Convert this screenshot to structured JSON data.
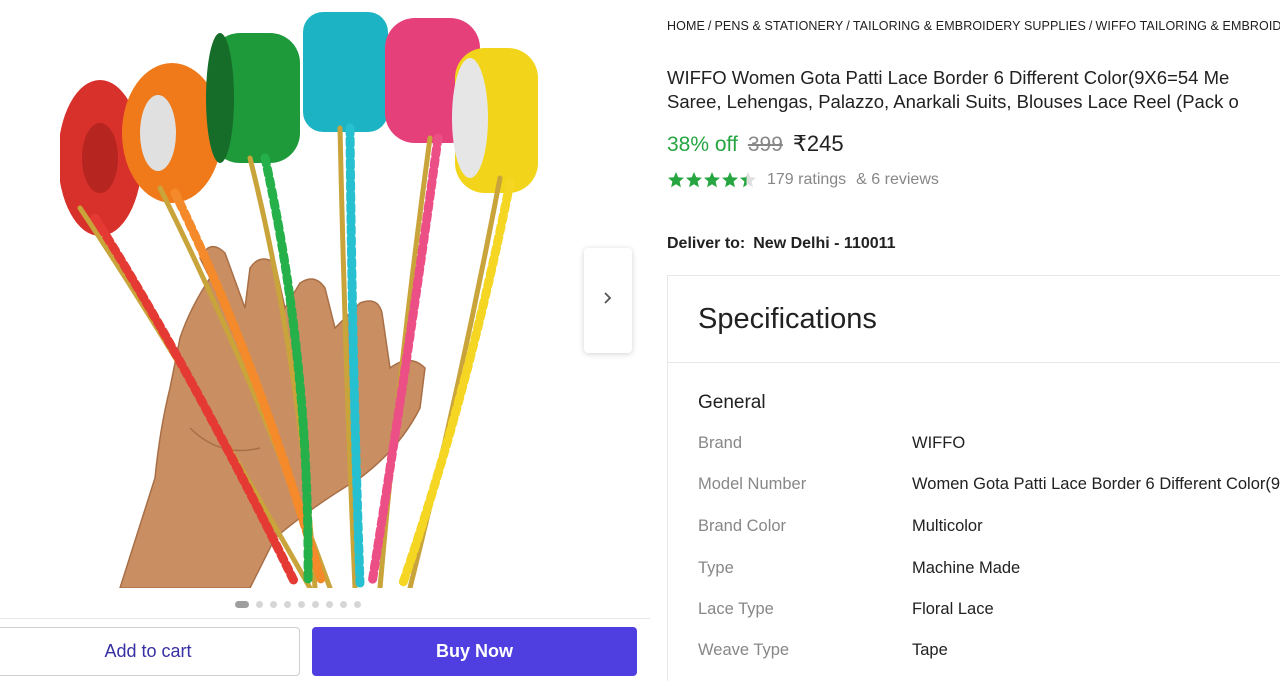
{
  "breadcrumb": [
    "HOME",
    "PENS & STATIONERY",
    "TAILORING & EMBROIDERY SUPPLIES",
    "WIFFO TAILORING & EMBROIDERY SU"
  ],
  "product": {
    "title_line1": "WIFFO Women Gota Patti Lace Border 6 Different Color(9X6=54 Me",
    "title_line2": "Saree, Lehengas, Palazzo, Anarkali Suits, Blouses Lace Reel (Pack o",
    "discount": "38% off",
    "mrp": "399",
    "price": "₹245",
    "rating_value": 4.4,
    "ratings_text": "179 ratings",
    "reviews_text": "& 6 reviews"
  },
  "delivery": {
    "label": "Deliver to:",
    "location": "New Delhi - 110011"
  },
  "gallery": {
    "dot_count": 9,
    "active_dot": 0,
    "image_alt": "multicolor gota patti lace reels held in hand"
  },
  "actions": {
    "add_to_cart": "Add to cart",
    "buy_now": "Buy Now"
  },
  "specifications": {
    "title": "Specifications",
    "group": "General",
    "rows": [
      {
        "key": "Brand",
        "value": "WIFFO"
      },
      {
        "key": "Model Number",
        "value": "Women Gota Patti Lace Border 6 Different Color(9"
      },
      {
        "key": "Brand Color",
        "value": "Multicolor"
      },
      {
        "key": "Type",
        "value": "Machine Made"
      },
      {
        "key": "Lace Type",
        "value": "Floral Lace"
      },
      {
        "key": "Weave Type",
        "value": "Tape"
      }
    ]
  },
  "colors": {
    "accent": "#4f3fe0",
    "discount": "#26a541",
    "star": "#26a541",
    "muted": "#878787"
  },
  "icons": {
    "next": "chevron-right-icon",
    "star": "star-icon"
  }
}
